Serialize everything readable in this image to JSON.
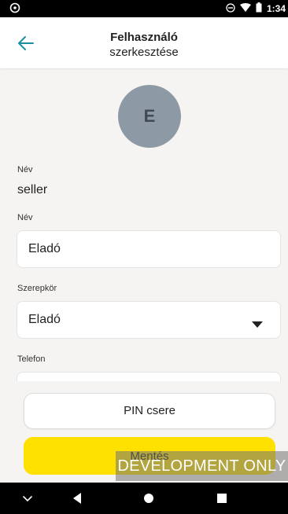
{
  "statusbar": {
    "time": "1:34",
    "left_icon": "circle-settings-icon",
    "right_icons": [
      "do-not-disturb-icon",
      "wifi-icon",
      "battery-icon"
    ]
  },
  "appbar": {
    "back_icon": "arrow-left-icon",
    "title_line1": "Felhasználó",
    "title_line2": "szerkesztése"
  },
  "avatar": {
    "initial": "E"
  },
  "form": {
    "username_label": "Név",
    "username_value": "seller",
    "name_label": "Név",
    "name_value": "Eladó",
    "role_label": "Szerepkör",
    "role_value": "Eladó",
    "phone_label": "Telefon",
    "phone_value": ""
  },
  "buttons": {
    "pin_label": "PIN csere",
    "save_label": "Mentés"
  },
  "dev_banner": "DEVELOPMENT ONLY",
  "colors": {
    "accent": "#1a8fa0",
    "save_button": "#ffe100",
    "avatar_bg": "#8d9aa5",
    "background": "#f5f4f2"
  },
  "navbar": {
    "icons": [
      "chevron-down-icon",
      "back-triangle-icon",
      "home-circle-icon",
      "recents-square-icon"
    ]
  }
}
